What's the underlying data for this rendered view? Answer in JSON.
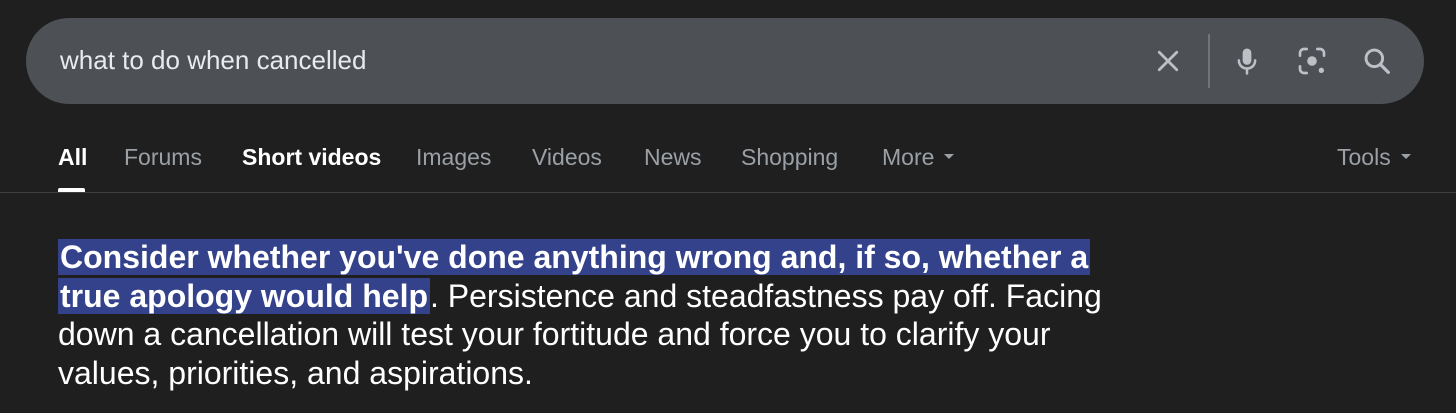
{
  "search": {
    "query": "what to do when cancelled"
  },
  "icons": {
    "clear": "close-icon",
    "mic": "microphone-icon",
    "lens": "camera-lens-icon",
    "search": "search-icon"
  },
  "tabs": [
    {
      "label": "All",
      "active": true
    },
    {
      "label": "Forums"
    },
    {
      "label": "Short videos"
    },
    {
      "label": "Images"
    },
    {
      "label": "Videos"
    },
    {
      "label": "News"
    },
    {
      "label": "Shopping"
    },
    {
      "label": "More"
    },
    {
      "label": "Tools"
    }
  ],
  "snippet": {
    "highlight": "Consider whether you've done anything wrong and, if so, whether a true apology would help",
    "rest": ". Persistence and steadfastness pay off. Facing down a cancellation will test your fortitude and force you to clarify your values, priorities, and aspirations."
  },
  "colors": {
    "background": "#1f1f1f",
    "search_bar": "#4d5156",
    "highlight": "#33428a",
    "inactive_tab": "#9aa0a6"
  }
}
